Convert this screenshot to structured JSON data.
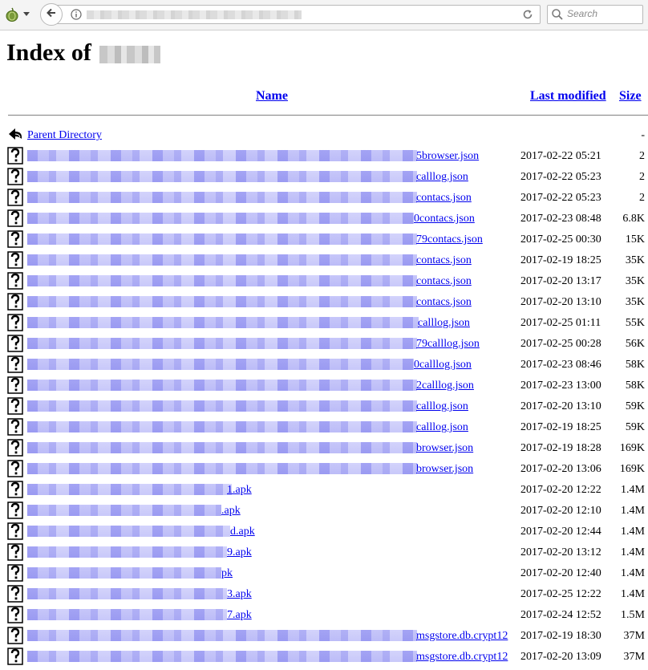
{
  "browser": {
    "tor_button": "onion-icon",
    "back_button": "back-arrow-icon",
    "info_icon": "info-icon",
    "reload_icon": "reload-icon",
    "search_placeholder": "Search"
  },
  "page": {
    "title": "Index of"
  },
  "table": {
    "headers": {
      "name": "Name",
      "last_modified": "Last modified",
      "size": "Size"
    },
    "parent": {
      "name": "Parent Directory",
      "size": "-"
    },
    "rows": [
      {
        "suffix": "5browser.json",
        "date": "2017-02-22 05:21",
        "size": "2"
      },
      {
        "suffix": "calllog.json",
        "date": "2017-02-22 05:23",
        "size": "2"
      },
      {
        "suffix": "contacs.json",
        "date": "2017-02-22 05:23",
        "size": "2"
      },
      {
        "suffix": "0contacs.json",
        "date": "2017-02-23 08:48",
        "size": "6.8K"
      },
      {
        "suffix": "79contacs.json",
        "date": "2017-02-25 00:30",
        "size": "15K"
      },
      {
        "suffix": "contacs.json",
        "date": "2017-02-19 18:25",
        "size": "35K"
      },
      {
        "suffix": "contacs.json",
        "date": "2017-02-20 13:17",
        "size": "35K"
      },
      {
        "suffix": "contacs.json",
        "date": "2017-02-20 13:10",
        "size": "35K"
      },
      {
        "suffix": "calllog.json",
        "date": "2017-02-25 01:11",
        "size": "55K"
      },
      {
        "suffix": "79calllog.json",
        "date": "2017-02-25 00:28",
        "size": "56K"
      },
      {
        "suffix": "0calllog.json",
        "date": "2017-02-23 08:46",
        "size": "58K"
      },
      {
        "suffix": "2calllog.json",
        "date": "2017-02-23 13:00",
        "size": "58K"
      },
      {
        "suffix": "calllog.json",
        "date": "2017-02-20 13:10",
        "size": "59K"
      },
      {
        "suffix": "calllog.json",
        "date": "2017-02-19 18:25",
        "size": "59K"
      },
      {
        "suffix": "browser.json",
        "date": "2017-02-19 18:28",
        "size": "169K"
      },
      {
        "suffix": "browser.json",
        "date": "2017-02-20 13:06",
        "size": "169K"
      },
      {
        "suffix": "1.apk",
        "date": "2017-02-20 12:22",
        "size": "1.4M"
      },
      {
        "suffix": ".apk",
        "date": "2017-02-20 12:10",
        "size": "1.4M"
      },
      {
        "suffix": "d.apk",
        "date": "2017-02-20 12:44",
        "size": "1.4M"
      },
      {
        "suffix": "9.apk",
        "date": "2017-02-20 13:12",
        "size": "1.4M"
      },
      {
        "suffix": "pk",
        "date": "2017-02-20 12:40",
        "size": "1.4M"
      },
      {
        "suffix": "3.apk",
        "date": "2017-02-25 12:22",
        "size": "1.4M"
      },
      {
        "suffix": "7.apk",
        "date": "2017-02-24 12:52",
        "size": "1.5M"
      },
      {
        "suffix": "msgstore.db.crypt12",
        "date": "2017-02-19 18:30",
        "size": "37M"
      },
      {
        "suffix": "msgstore.db.crypt12",
        "date": "2017-02-20 13:09",
        "size": "37M"
      }
    ]
  }
}
